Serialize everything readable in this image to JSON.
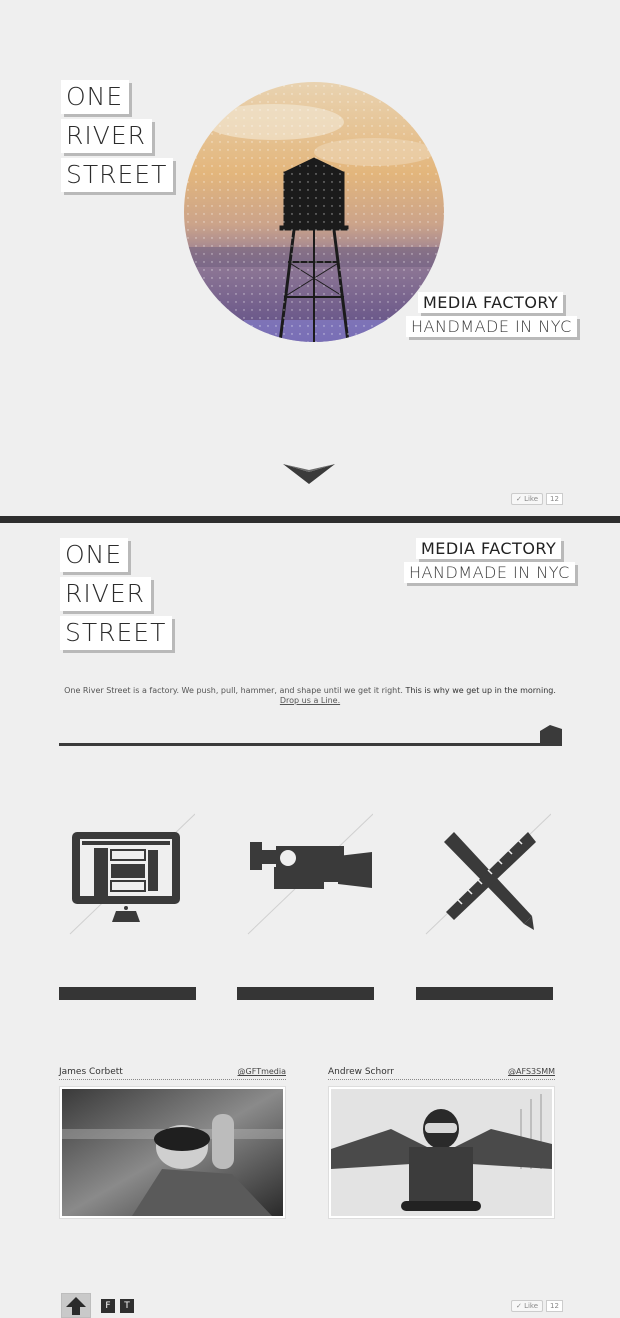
{
  "brand": {
    "logo_lines": [
      "ONE",
      "RIVER",
      "STREET"
    ],
    "tagline_1": "MEDIA FACTORY",
    "tagline_2": "HANDMADE IN NYC"
  },
  "like_widget": {
    "label": "✓ Like",
    "count": "12"
  },
  "intro": {
    "text_1": "One River Street is a factory. We push, pull, hammer, and shape until we get it right.",
    "text_2": "This is why we get up in the morning.",
    "link": "Drop us a Line."
  },
  "services": [
    {
      "icon": "monitor-icon"
    },
    {
      "icon": "video-camera-icon"
    },
    {
      "icon": "pen-ruler-icon"
    }
  ],
  "team": [
    {
      "name": "James Corbett",
      "handle": "@GFTmedia"
    },
    {
      "name": "Andrew Schorr",
      "handle": "@AFS3SMM"
    }
  ],
  "footer": {
    "social": [
      "F",
      "T"
    ]
  },
  "colors": {
    "background": "#efefef",
    "dark": "#2e2e2e",
    "accent_sky": "#e8b77a",
    "accent_dusk": "#6b5a93"
  }
}
